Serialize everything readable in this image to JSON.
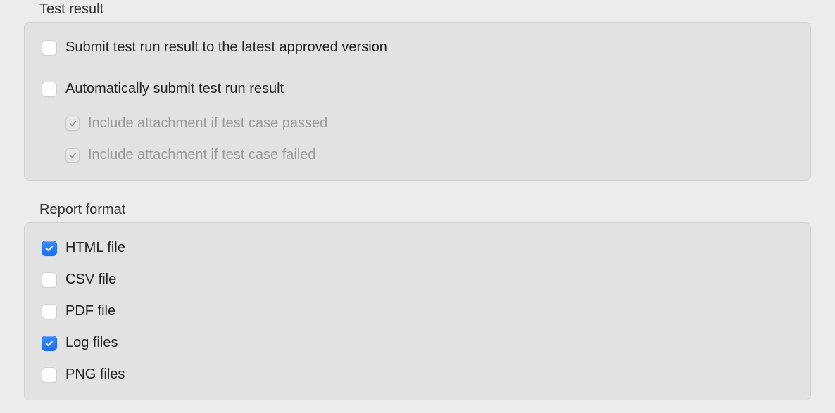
{
  "colors": {
    "accent": "#1e6ef0",
    "panel": "#e2e2e2",
    "bg": "#ececec",
    "disabled_text": "#9a9a9a"
  },
  "test_result": {
    "title": "Test result",
    "submit_to_latest": {
      "label": "Submit test run result to the latest approved version",
      "checked": false,
      "disabled": false
    },
    "auto_submit": {
      "label": "Automatically submit test run result",
      "checked": false,
      "disabled": false
    },
    "include_passed": {
      "label": "Include attachment if test case passed",
      "checked": true,
      "disabled": true
    },
    "include_failed": {
      "label": "Include attachment if test case failed",
      "checked": true,
      "disabled": true
    }
  },
  "report_format": {
    "title": "Report format",
    "html_file": {
      "label": "HTML file",
      "checked": true
    },
    "csv_file": {
      "label": "CSV file",
      "checked": false
    },
    "pdf_file": {
      "label": "PDF file",
      "checked": false
    },
    "log_files": {
      "label": "Log files",
      "checked": true
    },
    "png_files": {
      "label": "PNG files",
      "checked": false
    }
  }
}
